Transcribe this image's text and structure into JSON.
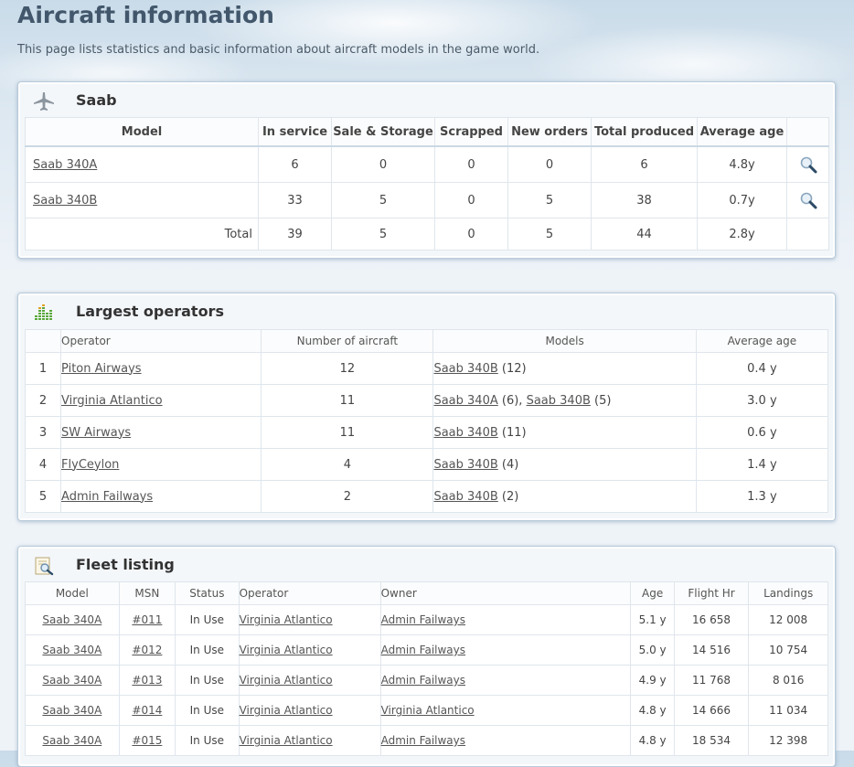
{
  "page": {
    "title": "Aircraft information",
    "description": "This page lists statistics and basic information about aircraft models in the game world."
  },
  "manufacturer_panel": {
    "title": "Saab",
    "icon": "airplane-icon",
    "headers": [
      "Model",
      "In service",
      "Sale & Storage",
      "Scrapped",
      "New orders",
      "Total produced",
      "Average age"
    ],
    "rows": [
      {
        "model": "Saab 340A",
        "in_service": "6",
        "sale_storage": "0",
        "scrapped": "0",
        "new_orders": "0",
        "total_produced": "6",
        "avg_age": "4.8y"
      },
      {
        "model": "Saab 340B",
        "in_service": "33",
        "sale_storage": "5",
        "scrapped": "0",
        "new_orders": "5",
        "total_produced": "38",
        "avg_age": "0.7y"
      }
    ],
    "total": {
      "label": "Total",
      "in_service": "39",
      "sale_storage": "5",
      "scrapped": "0",
      "new_orders": "5",
      "total_produced": "44",
      "avg_age": "2.8y"
    }
  },
  "operators_panel": {
    "title": "Largest operators",
    "icon": "bar-chart-icon",
    "headers": [
      "Operator",
      "Number of aircraft",
      "Models",
      "Average age"
    ],
    "rows": [
      {
        "rank": "1",
        "operator": "Piton Airways",
        "count": "12",
        "models": [
          {
            "name": "Saab 340B",
            "count": "(12)"
          }
        ],
        "avg_age": "0.4 y"
      },
      {
        "rank": "2",
        "operator": "Virginia Atlantico",
        "count": "11",
        "models": [
          {
            "name": "Saab 340A",
            "count": "(6),"
          },
          {
            "name": "Saab 340B",
            "count": "(5)"
          }
        ],
        "avg_age": "3.0 y"
      },
      {
        "rank": "3",
        "operator": "SW Airways",
        "count": "11",
        "models": [
          {
            "name": "Saab 340B",
            "count": "(11)"
          }
        ],
        "avg_age": "0.6 y"
      },
      {
        "rank": "4",
        "operator": "FlyCeylon",
        "count": "4",
        "models": [
          {
            "name": "Saab 340B",
            "count": "(4)"
          }
        ],
        "avg_age": "1.4 y"
      },
      {
        "rank": "5",
        "operator": "Admin Failways",
        "count": "2",
        "models": [
          {
            "name": "Saab 340B",
            "count": "(2)"
          }
        ],
        "avg_age": "1.3 y"
      }
    ]
  },
  "fleet_panel": {
    "title": "Fleet listing",
    "icon": "document-search-icon",
    "headers": [
      "Model",
      "MSN",
      "Status",
      "Operator",
      "Owner",
      "Age",
      "Flight Hr",
      "Landings"
    ],
    "rows": [
      {
        "model": "Saab 340A",
        "msn": "#011",
        "status": "In Use",
        "operator": "Virginia Atlantico",
        "owner": "Admin Failways",
        "age": "5.1 y",
        "flight_hr": "16 658",
        "landings": "12 008"
      },
      {
        "model": "Saab 340A",
        "msn": "#012",
        "status": "In Use",
        "operator": "Virginia Atlantico",
        "owner": "Admin Failways",
        "age": "5.0 y",
        "flight_hr": "14 516",
        "landings": "10 754"
      },
      {
        "model": "Saab 340A",
        "msn": "#013",
        "status": "In Use",
        "operator": "Virginia Atlantico",
        "owner": "Admin Failways",
        "age": "4.9 y",
        "flight_hr": "11 768",
        "landings": "8 016"
      },
      {
        "model": "Saab 340A",
        "msn": "#014",
        "status": "In Use",
        "operator": "Virginia Atlantico",
        "owner": "Virginia Atlantico",
        "age": "4.8 y",
        "flight_hr": "14 666",
        "landings": "11 034"
      },
      {
        "model": "Saab 340A",
        "msn": "#015",
        "status": "In Use",
        "operator": "Virginia Atlantico",
        "owner": "Admin Failways",
        "age": "4.8 y",
        "flight_hr": "18 534",
        "landings": "12 398"
      }
    ]
  }
}
